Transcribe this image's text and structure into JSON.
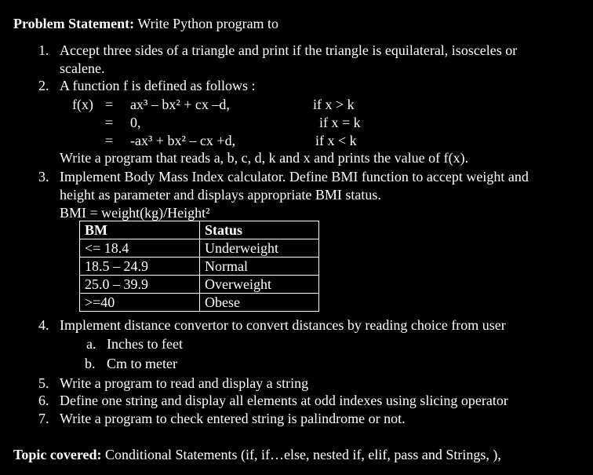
{
  "problem": {
    "heading": "Problem Statement:",
    "intro": "Write Python program to"
  },
  "item1": {
    "num": "1.",
    "line1": "Accept three sides of a triangle and print if the triangle is equilateral, isosceles or",
    "line2": "scalene."
  },
  "item2": {
    "num": "2.",
    "line1": "A function f is defined as follows :",
    "fx": "f(x)",
    "rows": [
      {
        "eq": "=",
        "expr": "ax³ – bx² + cx –d,",
        "cond": "if x > k"
      },
      {
        "eq": "=",
        "expr": "0,",
        "cond": "if x = k"
      },
      {
        "eq": "=",
        "expr": "-ax³ + bx² – cx +d,",
        "cond": "if x < k"
      }
    ],
    "outro": "Write a program that reads a, b, c, d, k and x and prints the value of f(x)."
  },
  "item3": {
    "num": "3.",
    "line1": "Implement Body Mass Index calculator. Define BMI function to accept weight and",
    "line2": "height as parameter and displays appropriate BMI status.",
    "formula": "BMI = weight(kg)/Height²",
    "table": {
      "headers": [
        "BM",
        "Status"
      ],
      "rows": [
        [
          "<= 18.4",
          "Underweight"
        ],
        [
          "18.5 – 24.9",
          "Normal"
        ],
        [
          "25.0 – 39.9",
          "Overweight"
        ],
        [
          ">=40",
          "Obese"
        ]
      ]
    }
  },
  "item4": {
    "num": "4.",
    "line1": "Implement distance convertor to convert distances by reading choice from user",
    "subs": [
      {
        "letter": "a.",
        "text": "Inches to feet"
      },
      {
        "letter": "b.",
        "text": "Cm to meter"
      }
    ]
  },
  "item5": {
    "num": "5.",
    "text": "Write a program to read and display a string"
  },
  "item6": {
    "num": "6.",
    "text": "Define one string and display all elements at odd indexes using slicing operator"
  },
  "item7": {
    "num": "7.",
    "text": "Write a program to check entered string is palindrome or not."
  },
  "topic": {
    "heading": "Topic covered:",
    "text": "Conditional Statements (if, if…else, nested if, elif, pass and Strings, ),"
  }
}
